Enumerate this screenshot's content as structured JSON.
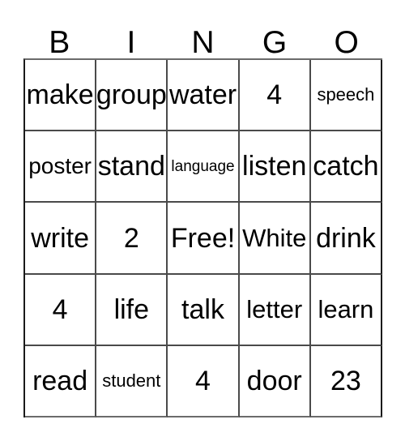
{
  "card": {
    "title": "BINGO",
    "headers": [
      "B",
      "I",
      "N",
      "G",
      "O"
    ],
    "colors": {
      "background": "#ffffff",
      "text": "#000000",
      "grid_line": "#4a4a4a",
      "grid_outer": "#1a1a1a"
    },
    "free_space_label": "Free!",
    "free_space_position": {
      "row": 3,
      "column": 3
    },
    "rows": [
      [
        {
          "text": "make",
          "size": "fs-xl"
        },
        {
          "text": "group",
          "size": "fs-xl"
        },
        {
          "text": "water",
          "size": "fs-xl"
        },
        {
          "text": "4",
          "size": "fs-xl"
        },
        {
          "text": "speech",
          "size": "fs-sm"
        }
      ],
      [
        {
          "text": "poster",
          "size": "fs-md"
        },
        {
          "text": "stand",
          "size": "fs-xl"
        },
        {
          "text": "language",
          "size": "fs-xs"
        },
        {
          "text": "listen",
          "size": "fs-xl"
        },
        {
          "text": "catch",
          "size": "fs-xl"
        }
      ],
      [
        {
          "text": "write",
          "size": "fs-xl"
        },
        {
          "text": "2",
          "size": "fs-xl"
        },
        {
          "text": "Free!",
          "size": "fs-xl"
        },
        {
          "text": "White",
          "size": "fs-lg"
        },
        {
          "text": "drink",
          "size": "fs-xl"
        }
      ],
      [
        {
          "text": "4",
          "size": "fs-xl"
        },
        {
          "text": "life",
          "size": "fs-xl"
        },
        {
          "text": "talk",
          "size": "fs-xl"
        },
        {
          "text": "letter",
          "size": "fs-lg"
        },
        {
          "text": "learn",
          "size": "fs-lg"
        }
      ],
      [
        {
          "text": "read",
          "size": "fs-xl"
        },
        {
          "text": "student",
          "size": "fs-sm"
        },
        {
          "text": "4",
          "size": "fs-xl"
        },
        {
          "text": "door",
          "size": "fs-xl"
        },
        {
          "text": "23",
          "size": "fs-xl"
        }
      ]
    ]
  }
}
